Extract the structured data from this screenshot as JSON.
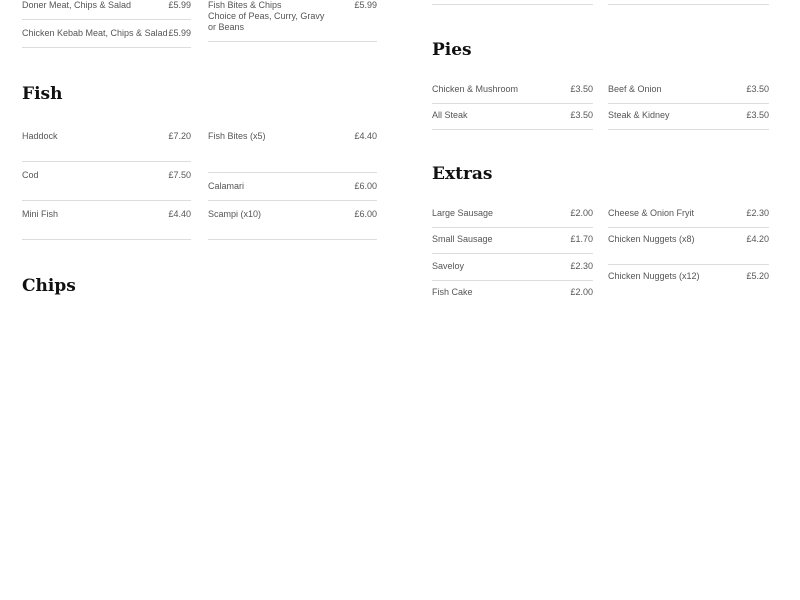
{
  "headings": {
    "fish": "Fish",
    "chips": "Chips",
    "pies": "Pies",
    "extras": "Extras"
  },
  "kebab": {
    "items": [
      {
        "name": "Doner Meat, Chips & Salad",
        "price": "£5.99"
      },
      {
        "name": "Chicken Kebab Meat, Chips & Salad",
        "price": "£5.99"
      },
      {
        "name": "Fish Bites & Chips",
        "desc": "Choice of Peas, Curry, Gravy or Beans",
        "price": "£5.99"
      }
    ]
  },
  "fish": {
    "items": [
      {
        "name": "Haddock",
        "price": "£7.20"
      },
      {
        "name": "Cod",
        "price": "£7.50"
      },
      {
        "name": "Mini Fish",
        "price": "£4.40"
      },
      {
        "name": "Fish Bites (x5)",
        "price": "£4.40"
      },
      {
        "name": "Calamari",
        "price": "£6.00"
      },
      {
        "name": "Scampi (x10)",
        "price": "£6.00"
      }
    ]
  },
  "pies": {
    "items": [
      {
        "name": "Chicken & Mushroom",
        "price": "£3.50"
      },
      {
        "name": "All Steak",
        "price": "£3.50"
      },
      {
        "name": "Beef & Onion",
        "price": "£3.50"
      },
      {
        "name": "Steak & Kidney",
        "price": "£3.50"
      }
    ]
  },
  "extras": {
    "items": [
      {
        "name": "Large Sausage",
        "price": "£2.00"
      },
      {
        "name": "Small Sausage",
        "price": "£1.70"
      },
      {
        "name": "Saveloy",
        "price": "£2.30"
      },
      {
        "name": "Fish Cake",
        "price": "£2.00"
      },
      {
        "name": "Cheese & Onion Fryit",
        "price": "£2.30"
      },
      {
        "name": "Chicken Nuggets (x8)",
        "price": "£4.20"
      },
      {
        "name": "Chicken Nuggets (x12)",
        "price": "£5.20"
      }
    ]
  }
}
